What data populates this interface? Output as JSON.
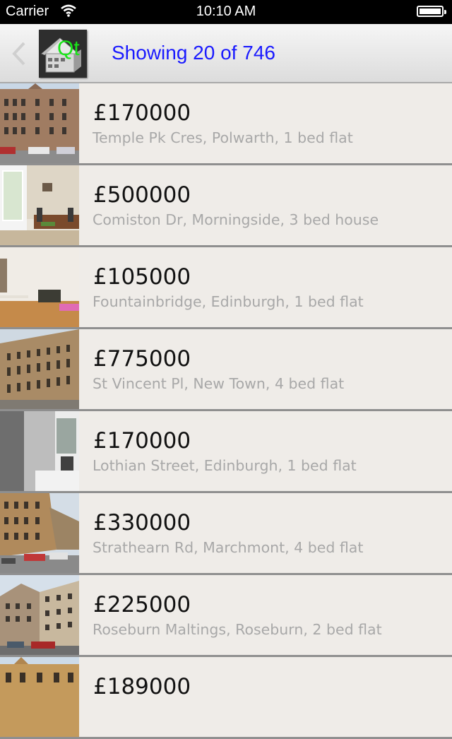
{
  "status_bar": {
    "carrier": "Carrier",
    "time": "10:10 AM",
    "icons": [
      "wifi-icon",
      "battery-icon"
    ]
  },
  "nav": {
    "back_icon": "chevron-left-icon",
    "logo_text": "Qt",
    "title": "Showing 20 of 746"
  },
  "colors": {
    "title": "#1a1aff",
    "logo_text": "#19e619",
    "row_background": "#efece8",
    "description": "#a8a8a8"
  },
  "listings": [
    {
      "price": "£170000",
      "description": "Temple Pk Cres, Polwarth, 1 bed flat",
      "thumbnail": "street-tenement-photo"
    },
    {
      "price": "£500000",
      "description": "Comiston Dr, Morningside, 3 bed house",
      "thumbnail": "dining-room-photo"
    },
    {
      "price": "£105000",
      "description": "Fountainbridge, Edinburgh, 1 bed flat",
      "thumbnail": "living-room-photo"
    },
    {
      "price": "£775000",
      "description": "St Vincent Pl, New Town, 4 bed flat",
      "thumbnail": "georgian-terrace-photo"
    },
    {
      "price": "£170000",
      "description": "Lothian Street, Edinburgh, 1 bed flat",
      "thumbnail": "interior-doors-photo"
    },
    {
      "price": "£330000",
      "description": "Strathearn Rd, Marchmont, 4 bed flat",
      "thumbnail": "street-cars-photo"
    },
    {
      "price": "£225000",
      "description": "Roseburn Maltings, Roseburn, 2 bed flat",
      "thumbnail": "apartment-block-photo"
    },
    {
      "price": "£189000",
      "description": "",
      "thumbnail": "sandstone-building-photo"
    }
  ]
}
